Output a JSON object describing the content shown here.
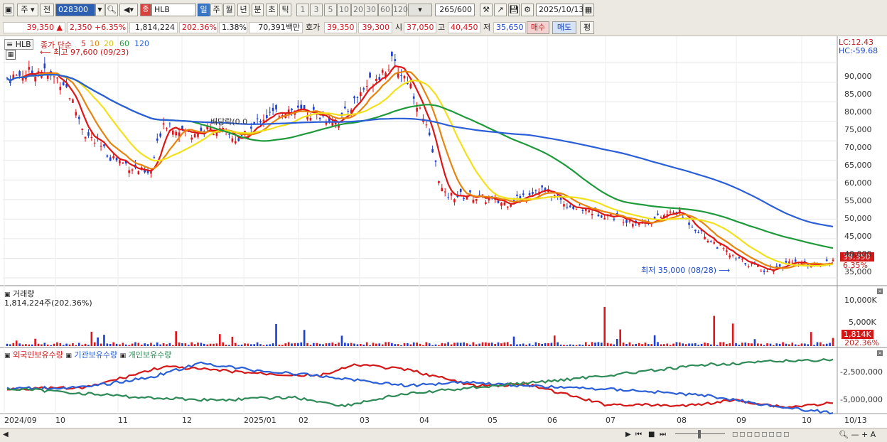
{
  "toolbar": {
    "market_tab": "주",
    "prev_label": "전",
    "stock_code": "028300",
    "name_badge": "종",
    "stock_name": "HLB",
    "periods": [
      "일",
      "주",
      "월",
      "년",
      "분",
      "초",
      "틱"
    ],
    "selected_period": "일",
    "intervals": [
      "1",
      "3",
      "5",
      "10",
      "20",
      "30",
      "60",
      "120"
    ],
    "bar_count": "265",
    "bar_total": "/600",
    "date": "2025/10/13"
  },
  "quote": {
    "price": "39,350",
    "arrow": "▲",
    "change": "2,350",
    "change_pct": "+6.35%",
    "volume": "1,814,224",
    "volume_ratio": "202.36%",
    "turnover": "1.38%",
    "amount": "70,391백만",
    "bid_label": "호가",
    "ask": "39,350",
    "bid": "39,300",
    "open_label": "시",
    "open": "37,050",
    "high_label": "고",
    "high": "40,450",
    "low_label": "저",
    "low": "35,650",
    "buy_button": "매수",
    "sell_button": "매도",
    "eval_button": "평"
  },
  "price_panel": {
    "symbol": "HLB",
    "ma_title": "종가 단순",
    "ma_periods": [
      "5",
      "10",
      "20",
      "60",
      "120"
    ],
    "ma_colors": [
      "#e01515",
      "#e8830e",
      "#f2e11a",
      "#1f9a3a",
      "#2b5fd8"
    ],
    "high_annotation": "최고 97,600 (09/23)",
    "low_annotation": "최저 35,000 (08/28)",
    "dividend_label": "배당락(0.0",
    "lc": "LC:12.43",
    "hc": "HC:-59.68",
    "last_price": "39,350",
    "last_pct": "6.35%"
  },
  "volume_panel": {
    "title": "거래량",
    "summary": "1,814,224주(202.36%)",
    "last_volume": "1,814K",
    "last_pct": "202.36%"
  },
  "holdings_panel": {
    "legend": [
      "외국인보유수량",
      "기관보유수량",
      "개인보유수량"
    ],
    "colors": [
      "#d41818",
      "#2b5fd8",
      "#2e8b57"
    ]
  },
  "chart_data": [
    {
      "type": "line",
      "title": "HLB 일봉",
      "x": [
        "2024/09",
        "10",
        "11",
        "12",
        "2025/01",
        "02",
        "03",
        "04",
        "05",
        "06",
        "07",
        "08",
        "09",
        "10",
        "10/13"
      ],
      "ylim": [
        33000,
        96000
      ],
      "yticks": [
        "90,000",
        "85,000",
        "80,000",
        "75,000",
        "70,000",
        "65,000",
        "60,000",
        "55,000",
        "50,000",
        "45,000",
        "40,000",
        "35,000"
      ],
      "series": [
        {
          "name": "5",
          "values": [
            86000,
            88000,
            84000,
            70000,
            65000,
            60000,
            73000,
            71000,
            72000,
            68000,
            78000,
            77000,
            76000,
            75000,
            84000,
            90000,
            88000,
            76000,
            58000,
            56000,
            54000,
            55000,
            57000,
            54000,
            53000,
            52000,
            49000,
            48000,
            51000,
            48000,
            39000,
            38000,
            38500,
            39000,
            39350
          ]
        },
        {
          "name": "120",
          "values": [
            84000,
            83000,
            81000,
            79000,
            76000,
            75000,
            76500,
            77000,
            77500,
            77000,
            76500,
            76000,
            75500,
            75500,
            76000,
            76500,
            76000,
            74000,
            72000,
            70000,
            68000,
            67000,
            66000,
            64000,
            62000,
            60000,
            58000,
            56000,
            54000,
            52000,
            50000,
            48500,
            47800,
            47500,
            47500
          ]
        }
      ]
    },
    {
      "type": "bar",
      "title": "거래량",
      "ylim": [
        0,
        12000000
      ],
      "yticks": [
        "10,000K",
        "5,000K"
      ],
      "last": 1814224
    },
    {
      "type": "line",
      "title": "외국인/기관/개인 보유수량",
      "ylim": [
        -6500000,
        0
      ],
      "yticks": [
        "-2,500,000",
        "-5,000,000"
      ],
      "series": [
        {
          "name": "외국인보유수량"
        },
        {
          "name": "기관보유수량"
        },
        {
          "name": "개인보유수량"
        }
      ]
    }
  ],
  "price_axis": [
    "90,000",
    "85,000",
    "80,000",
    "75,000",
    "70,000",
    "65,000",
    "60,000",
    "55,000",
    "50,000",
    "45,000",
    "40,000",
    "35,000"
  ],
  "x_axis": [
    "2024/09",
    "10",
    "11",
    "12",
    "2025/01",
    "02",
    "03",
    "04",
    "05",
    "06",
    "07",
    "08",
    "09",
    "10",
    "10/13"
  ]
}
